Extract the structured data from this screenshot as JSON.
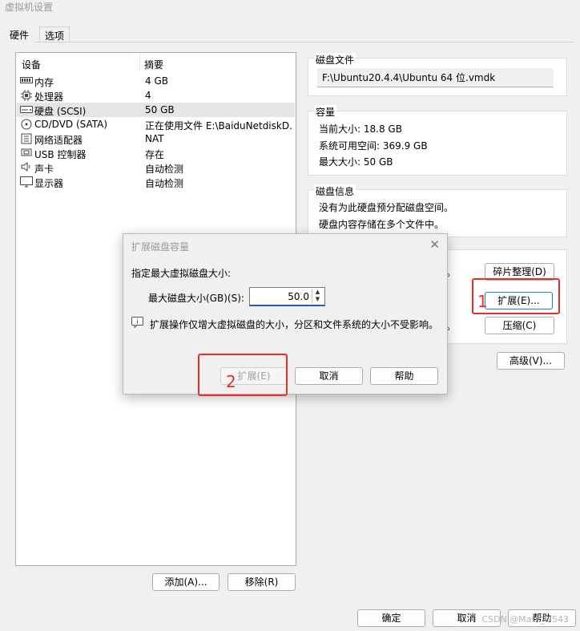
{
  "window": {
    "title": "虚拟机设置"
  },
  "tabs": [
    {
      "label": "硬件"
    },
    {
      "label": "选项"
    }
  ],
  "devices": {
    "headers": {
      "device": "设备",
      "summary": "摘要"
    },
    "items": [
      {
        "icon": "memory-icon",
        "name": "内存",
        "summary": "4 GB"
      },
      {
        "icon": "cpu-icon",
        "name": "处理器",
        "summary": "4"
      },
      {
        "icon": "harddisk-icon",
        "name": "硬盘 (SCSI)",
        "summary": "50 GB",
        "selected": true
      },
      {
        "icon": "cdrom-icon",
        "name": "CD/DVD (SATA)",
        "summary": "正在使用文件 E:\\BaiduNetdiskD..."
      },
      {
        "icon": "network-icon",
        "name": "网络适配器",
        "summary": "NAT"
      },
      {
        "icon": "usb-icon",
        "name": "USB 控制器",
        "summary": "存在"
      },
      {
        "icon": "speaker-icon",
        "name": "声卡",
        "summary": "自动检测"
      },
      {
        "icon": "monitor-icon",
        "name": "显示器",
        "summary": "自动检测"
      }
    ],
    "add_label": "添加(A)...",
    "remove_label": "移除(R)"
  },
  "disk_file": {
    "label": "磁盘文件",
    "path": "F:\\Ubuntu20.4.4\\Ubuntu 64 位.vmdk"
  },
  "capacity": {
    "label": "容量",
    "current": "当前大小: 18.8 GB",
    "free": "系统可用空间: 369.9 GB",
    "max": "最大大小: 50 GB"
  },
  "disk_info": {
    "label": "磁盘信息",
    "line1": "没有为此硬盘预分配磁盘空间。",
    "line2": "硬盘内容存储在多个文件中。"
  },
  "utilities": {
    "defrag_label": "碎片整理(D)",
    "expand_label": "扩展(E)...",
    "compact_label": "压缩(C)",
    "advanced_label": "高级(V)...",
    "text_fragment_1": "。",
    "text_fragment_2": "。"
  },
  "annotations": {
    "mark1": "1",
    "mark2": "2",
    "color": "#e8302b"
  },
  "dialog": {
    "title": "扩展磁盘容量",
    "prompt": "指定最大虚拟磁盘大小:",
    "size_label": "最大磁盘大小(GB)(S):",
    "size_value": "50.0",
    "info": "扩展操作仅增大虚拟磁盘的大小，分区和文件系统的大小不受影响。",
    "expand_label": "扩展(E)",
    "cancel_label": "取消",
    "help_label": "帮助"
  },
  "footer": {
    "ok_label": "确定",
    "cancel_label": "取消",
    "help_label": "帮助"
  },
  "watermark": "CSDN @Mark_Li543"
}
